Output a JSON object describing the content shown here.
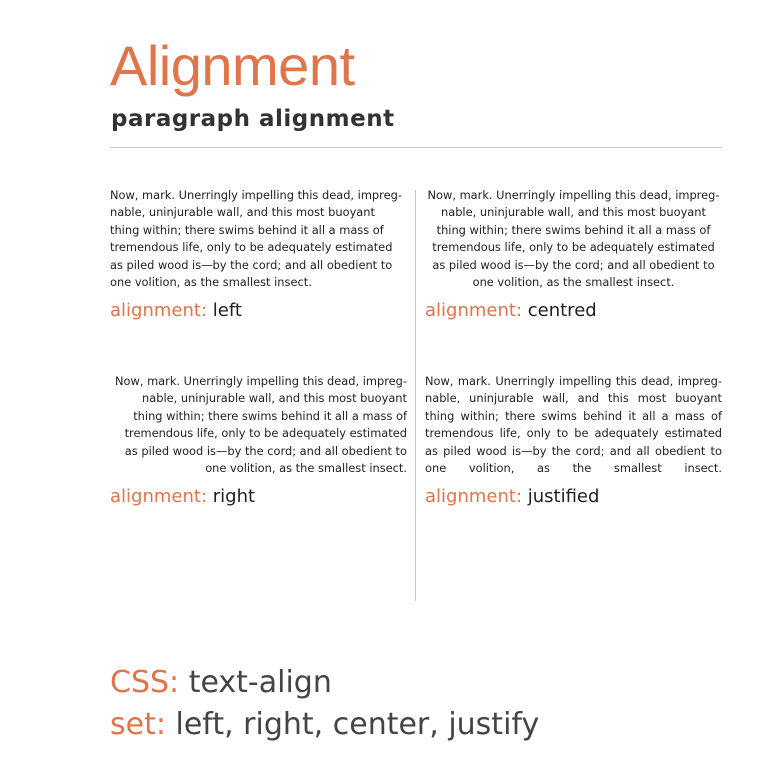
{
  "header": {
    "title": "Alignment",
    "subtitle": "paragraph alignment"
  },
  "panels": [
    {
      "text": "Now, mark. Unerringly impelling this dead, impreg­nable, uninjurable wall, and this most buoyant thing within; there swims behind it all a mass of tremendous life, only to be adequately estimated as piled wood is—by the cord; and all obedient to one volition, as the smallest insect.",
      "label": "alignment:",
      "value": "left"
    },
    {
      "text": "Now, mark. Unerringly impelling this dead, impreg­nable, uninjurable wall, and this most buoyant thing within; there swims behind it all a mass of tremendous life, only to be adequately estimated as piled wood is—by the cord; and all obedient to one volition, as the smallest insect.",
      "label": "alignment:",
      "value": "centred"
    },
    {
      "text": "Now, mark. Unerringly impelling this dead, impreg­nable, uninjurable wall, and this most buoyant thing within; there swims behind it all a mass of tremendous life, only to be adequately estimated as piled wood is—by the cord; and all obedient to one volition, as the smallest insect.",
      "label": "alignment:",
      "value": "right"
    },
    {
      "text": "Now, mark. Unerringly impelling this dead, impreg­nable, uninjurable wall, and this most buoyant thing within; there swims behind it all a mass of tremen­dous life, only to be adequately estimated as piled wood is—by the cord; and all obedient to one voli­tion, as the smallest insect.",
      "label": "alignment:",
      "value": "justified"
    }
  ],
  "footer": {
    "css_label": "CSS:",
    "css_value": "text-align",
    "set_label": "set:",
    "set_value": "left, right, center, justify"
  },
  "colors": {
    "accent": "#e0744a",
    "text": "#1f1f1f",
    "rule": "#c9c9c9"
  }
}
